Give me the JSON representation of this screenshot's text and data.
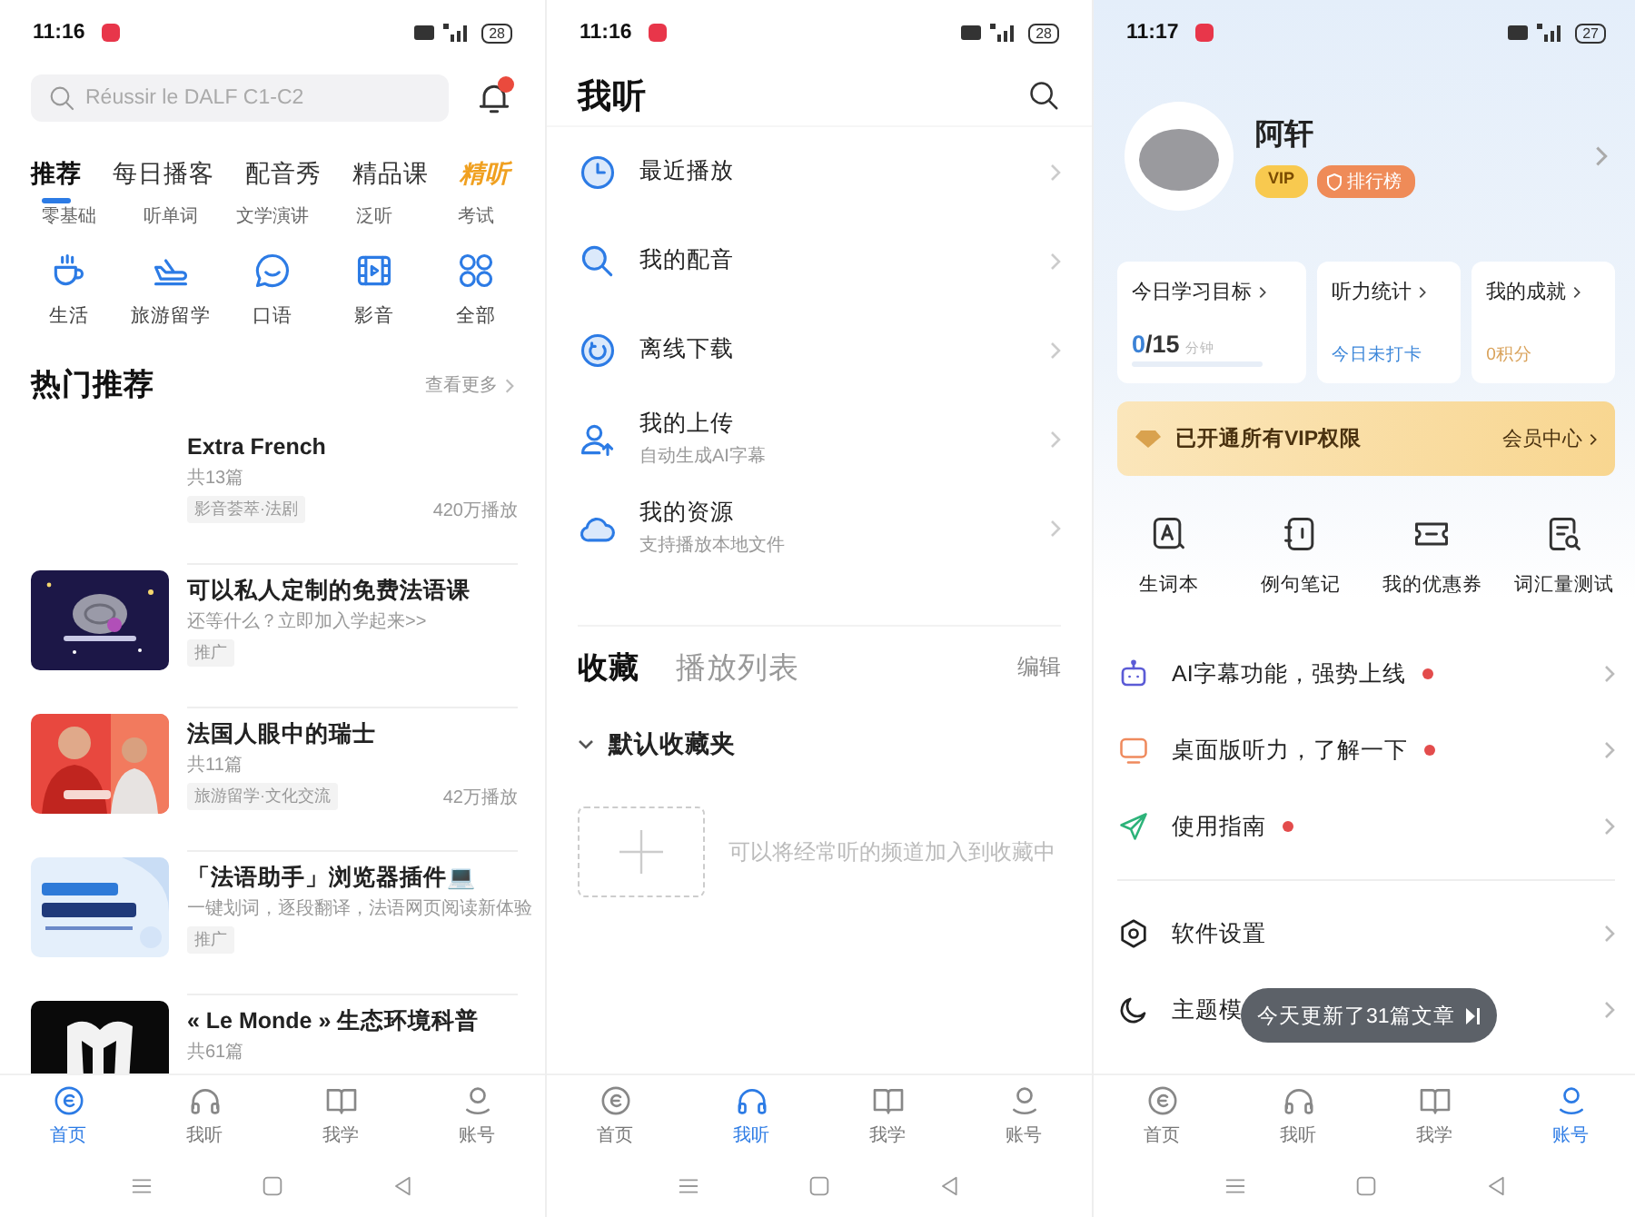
{
  "screens": [
    {
      "kind": "home",
      "status": {
        "time": "11:16",
        "battery": "28"
      },
      "search": {
        "placeholder": "Réussir le DALF C1-C2"
      },
      "notification_badge": true,
      "tabs": [
        {
          "label": "推荐",
          "selected": true,
          "kind": "text"
        },
        {
          "label": "每日播客",
          "selected": false,
          "kind": "text"
        },
        {
          "label": "配音秀",
          "selected": false,
          "kind": "text"
        },
        {
          "label": "精品课",
          "selected": false,
          "kind": "text"
        },
        {
          "label": "精听",
          "selected": false,
          "kind": "promo"
        }
      ],
      "subtabs": [
        "零基础",
        "听单词",
        "文学演讲",
        "泛听",
        "考试"
      ],
      "categories": [
        "生活",
        "旅游留学",
        "口语",
        "影音",
        "全部"
      ],
      "section": {
        "title": "热门推荐",
        "more": "查看更多"
      },
      "feed": [
        {
          "kind": "plain",
          "title": "Extra French",
          "subtitle": "共13篇",
          "tag": "影音荟萃·法剧",
          "plays": "420万播放"
        },
        {
          "kind": "picture",
          "title": "可以私人定制的免费法语课",
          "subtitle": "还等什么？立即加入学起来>>",
          "tag": "推广"
        },
        {
          "kind": "picture",
          "title": "法国人眼中的瑞士",
          "subtitle": "共11篇",
          "tag": "旅游留学·文化交流",
          "plays": "42万播放"
        },
        {
          "kind": "picture",
          "title": "「法语助手」浏览器插件💻",
          "subtitle": "一键划词，逐段翻译，法语网页阅读新体验",
          "tag": "推广"
        },
        {
          "kind": "picture",
          "title": "« Le Monde » 生态环境科普",
          "subtitle": "共61篇"
        }
      ],
      "nav": [
        {
          "label": "首页",
          "selected": true
        },
        {
          "label": "我听",
          "selected": false
        },
        {
          "label": "我学",
          "selected": false
        },
        {
          "label": "账号",
          "selected": false
        }
      ]
    },
    {
      "kind": "listen",
      "status": {
        "time": "11:16",
        "battery": "28"
      },
      "title": "我听",
      "menu": [
        {
          "title": "最近播放"
        },
        {
          "title": "我的配音"
        },
        {
          "title": "离线下载"
        },
        {
          "title": "我的上传",
          "subtitle": "自动生成AI字幕"
        },
        {
          "title": "我的资源",
          "subtitle": "支持播放本地文件"
        }
      ],
      "tabs": [
        {
          "label": "收藏",
          "selected": true
        },
        {
          "label": "播放列表",
          "selected": false
        }
      ],
      "edit": "编辑",
      "folder": {
        "label": "默认收藏夹",
        "expanded": true
      },
      "empty_hint": "可以将经常听的频道加入到收藏中",
      "nav": [
        {
          "label": "首页",
          "selected": false
        },
        {
          "label": "我听",
          "selected": true
        },
        {
          "label": "我学",
          "selected": false
        },
        {
          "label": "账号",
          "selected": false
        }
      ]
    },
    {
      "kind": "account",
      "status": {
        "time": "11:17",
        "battery": "27"
      },
      "profile": {
        "name": "阿轩",
        "vip": "VIP",
        "rank": "排行榜"
      },
      "stats": [
        {
          "title": "今日学习目标",
          "value": "0",
          "total": "/15",
          "unit": "分钟",
          "level": 0
        },
        {
          "title": "听力统计",
          "note": "今日未打卡"
        },
        {
          "title": "我的成就",
          "note": "0积分"
        }
      ],
      "vip_banner": {
        "text": "已开通所有VIP权限",
        "link": "会员中心"
      },
      "tools": [
        "生词本",
        "例句笔记",
        "我的优惠券",
        "词汇量测试"
      ],
      "menu": [
        {
          "label": "AI字幕功能，强势上线",
          "dot": true
        },
        {
          "label": "桌面版听力，了解一下",
          "dot": true
        },
        {
          "label": "使用指南",
          "dot": true
        }
      ],
      "settings": [
        {
          "label": "软件设置"
        },
        {
          "label": "主题模"
        }
      ],
      "toast": "今天更新了31篇文章",
      "nav": [
        {
          "label": "首页",
          "selected": false
        },
        {
          "label": "我听",
          "selected": false
        },
        {
          "label": "我学",
          "selected": false
        },
        {
          "label": "账号",
          "selected": true
        }
      ]
    }
  ]
}
